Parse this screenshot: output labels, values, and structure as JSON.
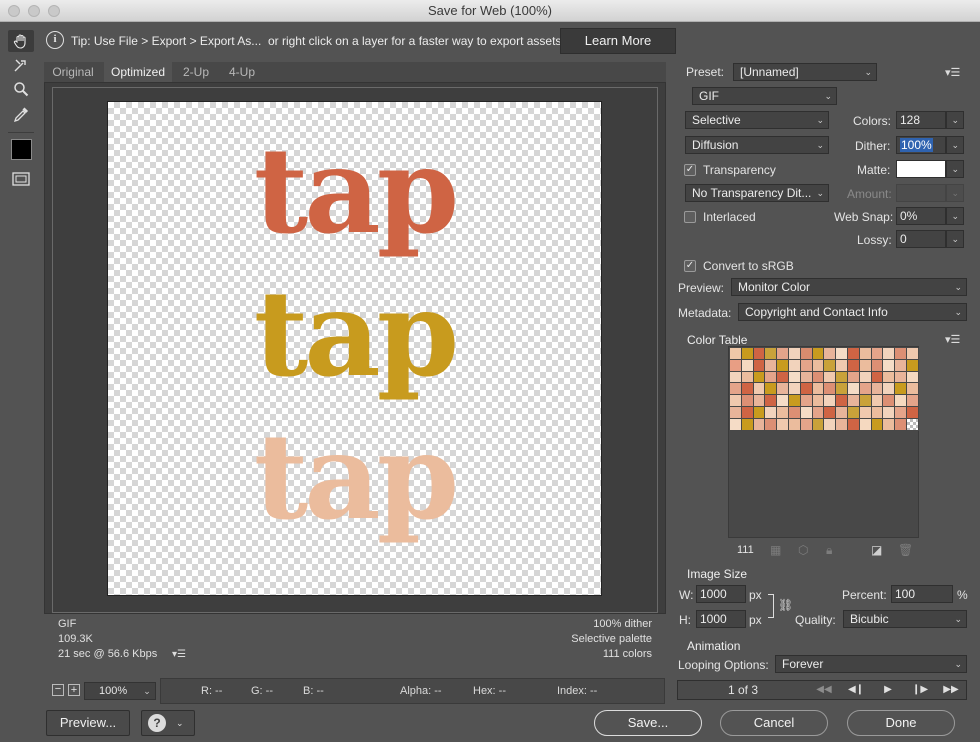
{
  "window": {
    "title": "Save for Web (100%)"
  },
  "tip": {
    "text": "Tip: Use File > Export > Export As...  or right click on a layer for a faster way to export assets",
    "learn_more": "Learn More"
  },
  "tabs": [
    {
      "label": "Original"
    },
    {
      "label": "Optimized"
    },
    {
      "label": "2-Up"
    },
    {
      "label": "4-Up"
    }
  ],
  "artwork": {
    "words": [
      "tap",
      "tap",
      "tap"
    ],
    "colors": [
      "#cf6444",
      "#c89b1e",
      "#ebbc9d"
    ]
  },
  "image_info": {
    "format": "GIF",
    "size": "109.3K",
    "time": "21 sec @ 56.6 Kbps",
    "dither": "100% dither",
    "palette": "Selective palette",
    "colors": "111 colors"
  },
  "zoom": {
    "value": "100%"
  },
  "readouts": {
    "r": "R: --",
    "g": "G: --",
    "b": "B: --",
    "alpha": "Alpha: --",
    "hex": "Hex: --",
    "index": "Index: --"
  },
  "footer": {
    "preview": "Preview...",
    "save": "Save...",
    "cancel": "Cancel",
    "done": "Done"
  },
  "settings": {
    "preset_label": "Preset:",
    "preset": "[Unnamed]",
    "format": "GIF",
    "reduction": "Selective",
    "colors_label": "Colors:",
    "colors": "128",
    "dither_algo": "Diffusion",
    "dither_label": "Dither:",
    "dither": "100%",
    "transparency": "Transparency",
    "matte_label": "Matte:",
    "transparency_dither": "No Transparency Dit...",
    "amount_label": "Amount:",
    "interlaced": "Interlaced",
    "websnap_label": "Web Snap:",
    "websnap": "0%",
    "lossy_label": "Lossy:",
    "lossy": "0",
    "convert_srgb": "Convert to sRGB",
    "preview_label": "Preview:",
    "preview": "Monitor Color",
    "metadata_label": "Metadata:",
    "metadata": "Copyright and Contact Info"
  },
  "color_table": {
    "title": "Color Table",
    "count": "111",
    "swatches": [
      "#efc8a8",
      "#c89b1e",
      "#cf6444",
      "#c9a23a",
      "#e4a48a",
      "#f2d3bc",
      "#d98c6e",
      "#c89b1e",
      "#e8b49a",
      "#f5dcc6",
      "#cf6444",
      "#ebbc9d",
      "#e4a48a",
      "#f2d3bc",
      "#dc8f74",
      "#f0c9ae",
      "#e89e84",
      "#f5d9c0",
      "#cf6444",
      "#e8b49a",
      "#c89b1e",
      "#f2d3bc",
      "#e4a48a",
      "#ebbc9d",
      "#c9a23a",
      "#f0c9ae",
      "#cf6444",
      "#ebbc9d",
      "#dc8f74",
      "#f5dcc6",
      "#e8b49a",
      "#c89b1e",
      "#f2d3bc",
      "#ebbc9d",
      "#c89b1e",
      "#e4a48a",
      "#cf6444",
      "#f5dcc6",
      "#e8b49a",
      "#dc8f74",
      "#f0c9ae",
      "#c9a23a",
      "#e4a48a",
      "#f2d3bc",
      "#cf6444",
      "#ebbc9d",
      "#e8b49a",
      "#f5d9c0",
      "#e4a48a",
      "#cf6444",
      "#f0c9ae",
      "#c89b1e",
      "#e8b49a",
      "#f2d3bc",
      "#cf6444",
      "#ebbc9d",
      "#dc8f74",
      "#c9a23a",
      "#f5dcc6",
      "#e4a48a",
      "#e8b49a",
      "#f2d3bc",
      "#c89b1e",
      "#ebbc9d",
      "#f0c9ae",
      "#dc8f74",
      "#e8b49a",
      "#cf6444",
      "#f5dcc6",
      "#c89b1e",
      "#e4a48a",
      "#ebbc9d",
      "#f2d3bc",
      "#cf6444",
      "#e8b49a",
      "#c9a23a",
      "#f0c9ae",
      "#dc8f74",
      "#f5d9c0",
      "#e4a48a",
      "#e8b49a",
      "#cf6444",
      "#c89b1e",
      "#f2d3bc",
      "#ebbc9d",
      "#dc8f74",
      "#f5dcc6",
      "#e4a48a",
      "#cf6444",
      "#e8b49a",
      "#c9a23a",
      "#f0c9ae",
      "#ebbc9d",
      "#f2d3bc",
      "#e4a48a",
      "#cf6444",
      "#f5dcc6",
      "#c89b1e",
      "#e8b49a",
      "#dc8f74",
      "#f0c9ae",
      "#ebbc9d",
      "#e4a48a",
      "#c9a23a",
      "#f2d3bc",
      "#e8b49a",
      "#cf6444",
      "#f5d9c0",
      "#c89b1e",
      "#ebbc9d",
      "#dc8f74"
    ]
  },
  "image_size": {
    "title": "Image Size",
    "w_label": "W:",
    "w": "1000",
    "h_label": "H:",
    "h": "1000",
    "px": "px",
    "percent_label": "Percent:",
    "percent": "100",
    "pct": "%",
    "quality_label": "Quality:",
    "quality": "Bicubic"
  },
  "animation": {
    "title": "Animation",
    "looping_label": "Looping Options:",
    "looping": "Forever",
    "frame": "1 of 3"
  }
}
